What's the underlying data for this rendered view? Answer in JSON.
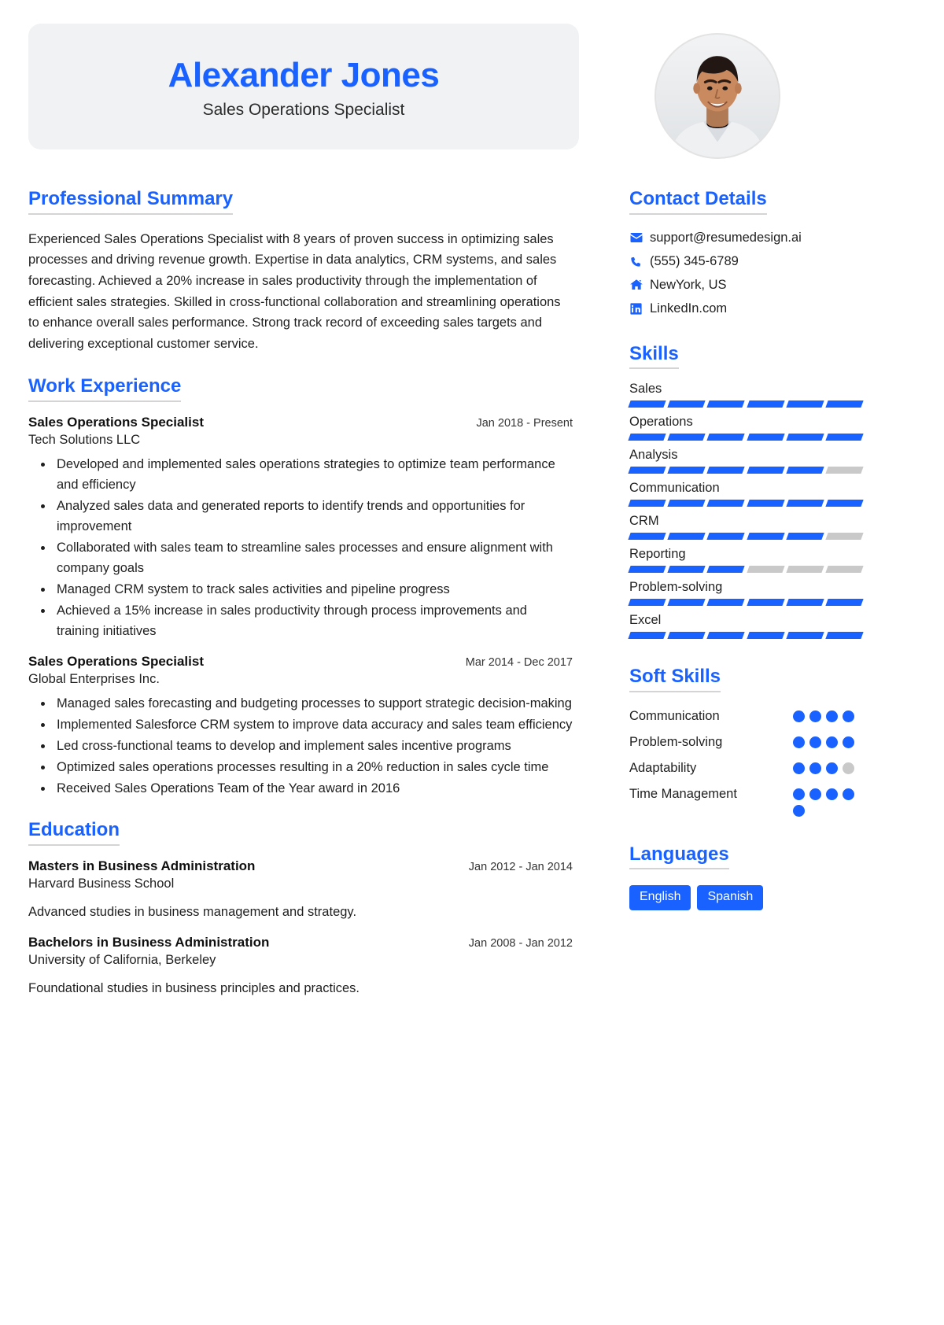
{
  "theme": {
    "accent": "#1a62ff",
    "muted": "#c9c9c9",
    "header_bg": "#f1f2f3"
  },
  "header": {
    "name": "Alexander Jones",
    "title": "Sales Operations Specialist"
  },
  "summary": {
    "heading": "Professional Summary",
    "text": "Experienced Sales Operations Specialist with 8 years of proven success in optimizing sales processes and driving revenue growth. Expertise in data analytics, CRM systems, and sales forecasting. Achieved a 20% increase in sales productivity through the implementation of efficient sales strategies. Skilled in cross-functional collaboration and streamlining operations to enhance overall sales performance. Strong track record of exceeding sales targets and delivering exceptional customer service."
  },
  "experience": {
    "heading": "Work Experience",
    "entries": [
      {
        "title": "Sales Operations Specialist",
        "date": "Jan 2018 - Present",
        "org": "Tech Solutions LLC",
        "bullets": [
          "Developed and implemented sales operations strategies to optimize team performance and efficiency",
          "Analyzed sales data and generated reports to identify trends and opportunities for improvement",
          "Collaborated with sales team to streamline sales processes and ensure alignment with company goals",
          "Managed CRM system to track sales activities and pipeline progress",
          "Achieved a 15% increase in sales productivity through process improvements and training initiatives"
        ]
      },
      {
        "title": "Sales Operations Specialist",
        "date": "Mar 2014 - Dec 2017",
        "org": "Global Enterprises Inc.",
        "bullets": [
          "Managed sales forecasting and budgeting processes to support strategic decision-making",
          "Implemented Salesforce CRM system to improve data accuracy and sales team efficiency",
          "Led cross-functional teams to develop and implement sales incentive programs",
          "Optimized sales operations processes resulting in a 20% reduction in sales cycle time",
          "Received Sales Operations Team of the Year award in 2016"
        ]
      }
    ]
  },
  "education": {
    "heading": "Education",
    "entries": [
      {
        "title": "Masters in Business Administration",
        "date": "Jan 2012 - Jan 2014",
        "org": "Harvard Business School",
        "desc": "Advanced studies in business management and strategy."
      },
      {
        "title": "Bachelors in Business Administration",
        "date": "Jan 2008 - Jan 2012",
        "org": "University of California, Berkeley",
        "desc": "Foundational studies in business principles and practices."
      }
    ]
  },
  "contact": {
    "heading": "Contact Details",
    "items": [
      {
        "icon": "envelope-icon",
        "value": "support@resumedesign.ai"
      },
      {
        "icon": "phone-icon",
        "value": "(555) 345-6789"
      },
      {
        "icon": "home-icon",
        "value": "NewYork, US"
      },
      {
        "icon": "linkedin-icon",
        "value": "LinkedIn.com"
      }
    ]
  },
  "skills": {
    "heading": "Skills",
    "max": 6,
    "items": [
      {
        "name": "Sales",
        "level": 6
      },
      {
        "name": "Operations",
        "level": 6
      },
      {
        "name": "Analysis",
        "level": 5
      },
      {
        "name": "Communication",
        "level": 6
      },
      {
        "name": "CRM",
        "level": 5
      },
      {
        "name": "Reporting",
        "level": 3
      },
      {
        "name": "Problem-solving",
        "level": 6
      },
      {
        "name": "Excel",
        "level": 6
      }
    ]
  },
  "soft_skills": {
    "heading": "Soft Skills",
    "max": 4,
    "items": [
      {
        "name": "Communication",
        "level": 4,
        "total": 4
      },
      {
        "name": "Problem-solving",
        "level": 4,
        "total": 4
      },
      {
        "name": "Adaptability",
        "level": 3,
        "total": 4
      },
      {
        "name": "Time Management",
        "level": 5,
        "total": 5
      }
    ]
  },
  "languages": {
    "heading": "Languages",
    "items": [
      "English",
      "Spanish"
    ]
  }
}
